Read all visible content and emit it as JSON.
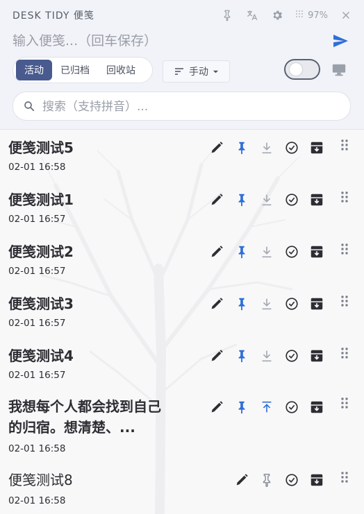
{
  "app": {
    "title": "DESK TIDY 便笺",
    "opacity": "97%"
  },
  "titlebar_icons": [
    "pin-icon",
    "translate-icon",
    "gear-icon",
    "opacity-dots-icon",
    "close-icon"
  ],
  "compose": {
    "placeholder": "输入便笺...（回车保存）"
  },
  "tabs": [
    {
      "label": "活动",
      "active": true
    },
    {
      "label": "已归档",
      "active": false
    },
    {
      "label": "回收站",
      "active": false
    }
  ],
  "sort": {
    "label": "手动"
  },
  "toggle": {
    "on": false
  },
  "search": {
    "placeholder": "搜索（支持拼音）..."
  },
  "notes": [
    {
      "title": "便笺测试5",
      "time": "02-01 16:58",
      "pinned": true
    },
    {
      "title": "便笺测试1",
      "time": "02-01 16:57",
      "pinned": true
    },
    {
      "title": "便笺测试2",
      "time": "02-01 16:57",
      "pinned": true
    },
    {
      "title": "便笺测试3",
      "time": "02-01 16:57",
      "pinned": true
    },
    {
      "title": "便笺测试4",
      "time": "02-01 16:57",
      "pinned": true
    },
    {
      "title": "我想每个人都会找到自己的归宿。想清楚、...",
      "time": "02-01 16:58",
      "pinned": true
    },
    {
      "title": "便笺测试8",
      "time": "02-01 16:58",
      "pinned": false
    }
  ],
  "colors": {
    "accent": "#485a8e",
    "pin_blue": "#2f6fd8",
    "send_blue": "#2f6fd8",
    "icon_gray": "#9aa0aa"
  }
}
